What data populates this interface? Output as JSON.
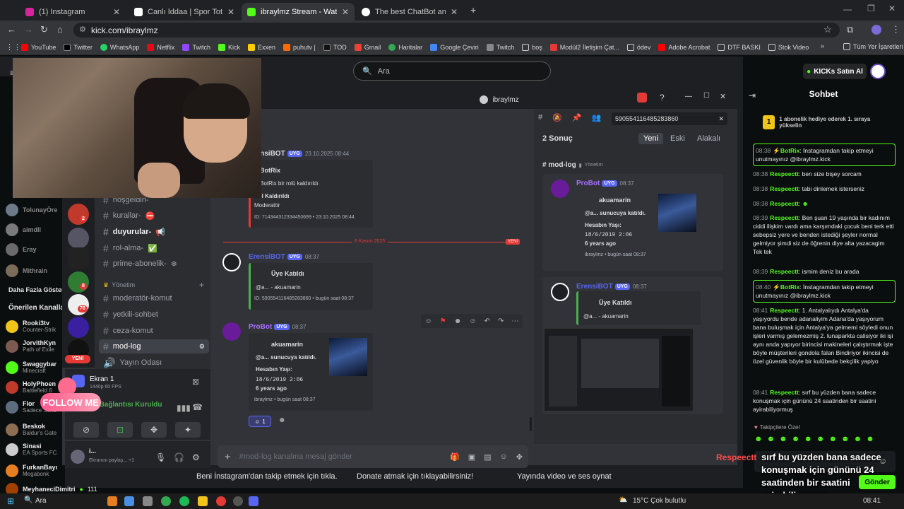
{
  "browser": {
    "tabs": [
      {
        "title": "(1) Instagram",
        "color": "#d6249f"
      },
      {
        "title": "Canlı İddaa | Spor Toto | Canlı B",
        "color": "#ffffff"
      },
      {
        "title": "ibraylmz Stream - Watch Live o",
        "color": "#53fc18"
      },
      {
        "title": "The best ChatBot and Widgets",
        "color": "#ffffff"
      }
    ],
    "url": "kick.com/ibraylmz",
    "bookmarks": [
      "YouTube",
      "Twitter",
      "WhatsApp",
      "Netflix",
      "Twitch",
      "Kick",
      "Exxen",
      "puhutv |",
      "TOD",
      "Gmail",
      "Haritalar",
      "Google Çeviri",
      "Twitch",
      "boş",
      "Modül2 İletişim Çat...",
      "ödev",
      "Adobe Acrobat",
      "DTF BASKI",
      "Stok Video"
    ],
    "bookmarks_all": "Tüm Yer İşaretleri"
  },
  "kick": {
    "search_placeholder": "Ara",
    "buy_kicks": "KICKs Satın Al",
    "sidebar": {
      "channels_top": [
        {
          "name": "TolunayÖre",
          "color": "#6c7a89"
        },
        {
          "name": "aimdll",
          "color": "#7a7a7a"
        },
        {
          "name": "Eray",
          "color": "#6a6a6a"
        },
        {
          "name": "Mithrain",
          "color": "#7b6b5b"
        }
      ],
      "more": "Daha Fazla Göster",
      "recommended_title": "Önerilen Kanalla",
      "recommended": [
        {
          "name": "Rooki3tv",
          "game": "Counter-Strik",
          "color": "#f0c419"
        },
        {
          "name": "JorvithKyn",
          "game": "Path of Exile",
          "color": "#7d5a50"
        },
        {
          "name": "Swaggybar",
          "game": "Minecraft",
          "color": "#53fc18"
        },
        {
          "name": "HolyPhoen",
          "game": "Battlefield 6",
          "color": "#c0392b"
        },
        {
          "name": "Flor",
          "game": "Sadece Sohb",
          "color": "#5d6d7e"
        },
        {
          "name": "Beskok",
          "game": "Baldur's Gate",
          "color": "#8e6e53"
        },
        {
          "name": "Sinasi",
          "game": "EA Sports FC",
          "color": "#cccccc"
        },
        {
          "name": "FurkanBayı",
          "game": "Megabonk",
          "color": "#e67e22"
        },
        {
          "name": "MeyhaneciDimitri",
          "game": "",
          "color": "#a04000"
        }
      ],
      "viewer_count": "111"
    },
    "chat": {
      "title": "Sohbet",
      "gift_text": "1 abonelik hediye ederek 1. sıraya yükselin",
      "gift_count": "1",
      "messages": [
        {
          "time": "08:38",
          "user": "BotRix",
          "text": "İnstagramdan takip etmeyi unutmayınız @ibraylmz.kick",
          "highlight": true
        },
        {
          "time": "08:38",
          "user": "Respeectt",
          "text": "ben size bişey sorcam",
          "highlight": false
        },
        {
          "time": "08:38",
          "user": "Respeectt",
          "text": "tabi dinlemek isterseniz",
          "highlight": false
        },
        {
          "time": "08:38",
          "user": "Respeectt",
          "text": "",
          "highlight": false
        },
        {
          "time": "08:39",
          "user": "Respeectt",
          "text": "Ben şuan 19 yaşında bir kadınım ciddi ilişkim vardı ama karşımdaki çocuk beni terk etti sebepsiz yere ve benden istediği şeyler normal gelmiyor şimdi siz de öğrenin diye alta yazacagim Tek tek",
          "highlight": false
        },
        {
          "time": "08:39",
          "user": "Respeectt",
          "text": "ismim deniz bu arada",
          "highlight": false
        },
        {
          "time": "08:40",
          "user": "BotRix",
          "text": "İnstagramdan takip etmeyi unutmayınız @ibraylmz.kick",
          "highlight": true
        },
        {
          "time": "08:41",
          "user": "Respeectt",
          "text": "1. Antalyalıydı Antalya'da yaşıyordu bende adanaliyim Adana'da yaşıyorum bana buluşmak için Antalya'ya gelmemi söyledi onun işleri varmış gelemezmiş 2. lunaparkta calisiyor iki işi aynı anda yapıyor birincisi makineleri çalıştırmak işte böyle müşterileri gondola falan Bindiriyor ikincisi de özel güvenlik böyle bir kulübede bekçilik yapiyo",
          "highlight": false
        },
        {
          "time": "08:41",
          "user": "Respeectt",
          "text": "sırf bu yüzden bana sadece konuşmak için gününü 24 saatinden bir saatini ayirabiliyormuş",
          "highlight": false
        }
      ],
      "follower_only": "Takipçilere Özel",
      "send": "Gönder"
    },
    "bottom_links": [
      "Beni İnstagram'dan takip etmek için tıkla.",
      "Donate atmak için tıklayabilirsiniz!",
      "Yayında video ve ses oynat"
    ]
  },
  "overlay": {
    "username": "Respeectt",
    "text": "sırf bu yüzden bana sadece konuşmak için gününü 24 saatinden bir saatini ayirabiliyormuş",
    "follow": "FOLLOW ME",
    "yeni": "YENİ"
  },
  "discord": {
    "window_title": "ibraylmz",
    "channels": [
      {
        "name": "hoşgeldin-",
        "style": "normal"
      },
      {
        "name": "kurallar-",
        "style": "normal"
      },
      {
        "name": "duyurular-",
        "style": "bold"
      },
      {
        "name": "rol-alma-",
        "style": "normal"
      },
      {
        "name": "prime-abonelik-",
        "style": "normal"
      }
    ],
    "category": "Yönetim",
    "mod_channels": [
      {
        "name": "moderatör-komut",
        "style": "normal"
      },
      {
        "name": "yetkili-sohbet",
        "style": "normal"
      },
      {
        "name": "ceza-komut",
        "style": "normal"
      },
      {
        "name": "mod-log",
        "style": "selected"
      },
      {
        "name": "Yayın Odası",
        "style": "normal"
      }
    ],
    "guild_badges": [
      "2",
      "8",
      "76"
    ],
    "voice": {
      "screen": "Ekran 1",
      "quality": "1440p 60 FPS",
      "status": "Ses Bağlantısı Kuruldu"
    },
    "user": {
      "name": "i...",
      "status": "Ekranını paylaş... +1"
    },
    "messages": {
      "m1": {
        "user": "ErensiBOT",
        "tag": "UYG",
        "time": "23.10.2025 08:44",
        "embed_title": "BotRix",
        "embed_line": "@BotRix bir rolü kaldırıldı",
        "field_name": "Rol Kaldırıldı",
        "field_value": "Moderatör",
        "footer": "ID: 714344312334450699 • 23.10.2025 08:44"
      },
      "divider": "6 Kasım 2025",
      "divider_new": "YENİ",
      "m2": {
        "user": "ErensiBOT",
        "tag": "UYG",
        "time": "08:37",
        "embed_title": "Üye Katıldı",
        "embed_line": "@a... - akuamarin",
        "footer": "ID: 590554116485283860 • bugün saat 08:37"
      },
      "m3": {
        "user": "ProBot",
        "tag": "UYG",
        "time": "08:37",
        "embed_title": "akuamarin",
        "embed_line": "@a... sunucuya katıldı.",
        "field_name": "Hesabın Yaşı:",
        "date": "18/6/2019 2:06",
        "age": "6 years ago",
        "footer": "ibraylmz • bugün saat 08:37"
      },
      "reaction_count": "1"
    },
    "composer_placeholder": "#mod-log kanalına mesaj gönder",
    "search": {
      "query": "590554116485283860",
      "results": "2 Sonuç",
      "sort": [
        "Yeni",
        "Eski",
        "Alakalı"
      ],
      "channel": "# mod-log",
      "channel_category": "Yönetim",
      "r1": {
        "user": "ProBot",
        "tag": "UYG",
        "time": "08:37",
        "embed_title": "akuamarin",
        "embed_line": "@a... sunucuya katıldı.",
        "field_name": "Hesabın Yaşı:",
        "date": "18/6/2019 2:06",
        "age": "6 years ago",
        "footer": "ibraylmz • bugün saat 08:37"
      },
      "r2": {
        "user": "ErensiBOT",
        "tag": "UYG",
        "time": "08:37",
        "embed_title": "Üye Katıldı",
        "embed_line": "@a... - akuamarin"
      }
    }
  },
  "taskbar": {
    "search": "Ara",
    "weather": "15°C  Çok bulutlu",
    "clock": "08:41"
  }
}
